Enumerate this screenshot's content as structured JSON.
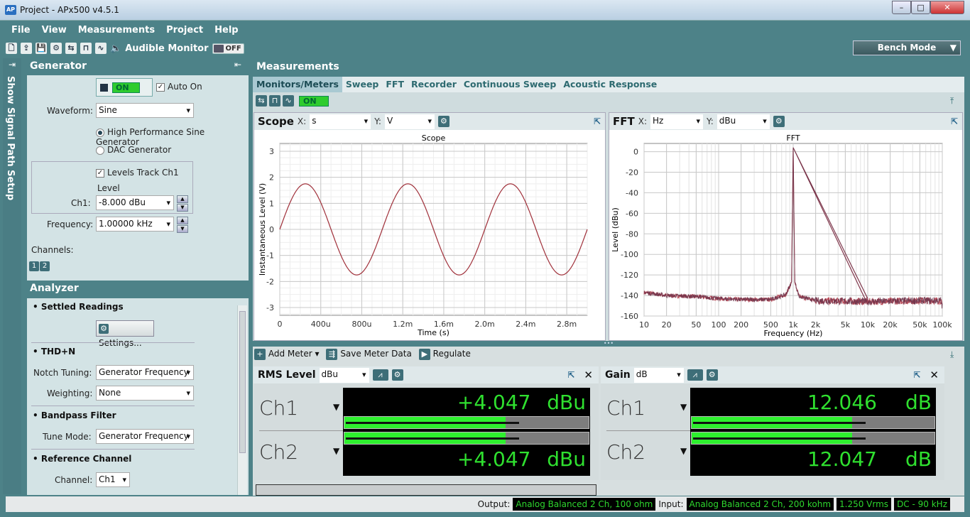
{
  "window": {
    "title": "Project - APx500 v4.5.1",
    "logo": "AP",
    "minimize": "–",
    "maximize": "□",
    "close": "✕"
  },
  "menu": [
    "File",
    "View",
    "Measurements",
    "Project",
    "Help"
  ],
  "toolbar": {
    "audible_monitor": "Audible Monitor",
    "audible_state": "OFF",
    "bench_mode": "Bench Mode"
  },
  "sidebar": {
    "signal_path": "Show Signal Path Setup"
  },
  "generator": {
    "title": "Generator",
    "state": "ON",
    "auto_on": "Auto On",
    "waveform_label": "Waveform:",
    "waveform": "Sine",
    "opt_hp": "High Performance Sine Generator",
    "opt_dac": "DAC Generator",
    "levels_track": "Levels Track Ch1",
    "level_label": "Level",
    "ch1_label": "Ch1:",
    "ch1_value": "-8.000 dBu",
    "freq_label": "Frequency:",
    "freq_value": "1.00000 kHz",
    "channels_label": "Channels:",
    "channels": [
      "1",
      "2"
    ]
  },
  "analyzer": {
    "title": "Analyzer",
    "settled": "Settled Readings",
    "settings_btn": "Settings...",
    "thdn": "THD+N",
    "notch_label": "Notch Tuning:",
    "notch": "Generator Frequency",
    "weighting_label": "Weighting:",
    "weighting": "None",
    "bandpass": "Bandpass Filter",
    "tune_label": "Tune Mode:",
    "tune": "Generator Frequency",
    "refch": "Reference Channel",
    "channel_label": "Channel:",
    "channel": "Ch1"
  },
  "measurements": {
    "title": "Measurements",
    "tabs": [
      "Monitors/Meters",
      "Sweep",
      "FFT",
      "Recorder",
      "Continuous Sweep",
      "Acoustic Response"
    ],
    "active_tab": "Monitors/Meters",
    "state": "ON"
  },
  "scope": {
    "title": "Scope",
    "x_label": "X:",
    "x_unit": "s",
    "y_label": "Y:",
    "y_unit": "V"
  },
  "fft": {
    "title": "FFT",
    "x_label": "X:",
    "x_unit": "Hz",
    "y_label": "Y:",
    "y_unit": "dBu"
  },
  "chart_data": [
    {
      "type": "line",
      "title": "Scope",
      "xlabel": "Time (s)",
      "ylabel": "Instantaneous Level (V)",
      "xlim": [
        0,
        0.003
      ],
      "ylim": [
        -3.3,
        3.3
      ],
      "grid": true,
      "xticks": [
        0,
        0.0004,
        0.0008,
        0.0012,
        0.0016,
        0.002,
        0.0024,
        0.0028
      ],
      "xtick_labels": [
        "0",
        "400u",
        "800u",
        "1.2m",
        "1.6m",
        "2.0m",
        "2.4m",
        "2.8m"
      ],
      "yticks": [
        3,
        2,
        1,
        0,
        -1,
        -2,
        -3
      ],
      "ytick_labels": [
        "3",
        "2",
        "1",
        "0",
        "-1",
        "-2",
        "-3"
      ],
      "series": [
        {
          "waveform": "sine",
          "amplitude_V": 1.75,
          "frequency_Hz": 1000,
          "color": "#a0303a"
        }
      ]
    },
    {
      "type": "line",
      "title": "FFT",
      "xlabel": "Frequency (Hz)",
      "ylabel": "Level (dBu)",
      "xscale": "log",
      "xlim": [
        10,
        100000
      ],
      "ylim": [
        -160,
        8
      ],
      "grid": true,
      "xticks": [
        10,
        20,
        50,
        100,
        200,
        500,
        1000,
        2000,
        5000,
        10000,
        20000,
        50000,
        100000
      ],
      "xtick_labels": [
        "10",
        "20",
        "50",
        "100",
        "200",
        "500",
        "1k",
        "2k",
        "5k",
        "10k",
        "20k",
        "50k",
        "100k"
      ],
      "yticks": [
        0,
        -20,
        -40,
        -60,
        -80,
        -100,
        -120,
        -140,
        -160
      ],
      "ytick_labels": [
        "0",
        "-20",
        "-40",
        "-60",
        "-80",
        "-100",
        "-120",
        "-140",
        "-160"
      ],
      "series": [
        {
          "color": "#b03040",
          "points": [
            [
              10,
              -137
            ],
            [
              20,
              -140
            ],
            [
              50,
              -141
            ],
            [
              100,
              -143
            ],
            [
              200,
              -144
            ],
            [
              500,
              -144
            ],
            [
              800,
              -139
            ],
            [
              950,
              -127
            ],
            [
              1000,
              4
            ],
            [
              1050,
              -127
            ],
            [
              1200,
              -141
            ],
            [
              2000,
              -145
            ],
            [
              10000,
              -146
            ],
            [
              50000,
              -145
            ],
            [
              95000,
              -145
            ],
            [
              100000,
              -151
            ]
          ]
        }
      ]
    }
  ],
  "meter_toolbar": {
    "add": "Add Meter",
    "save": "Save Meter Data",
    "regulate": "Regulate"
  },
  "meters": [
    {
      "title": "RMS Level",
      "unit_select": "dBu",
      "channels": [
        {
          "name": "Ch1",
          "value": "+4.047",
          "unit": "dBu"
        },
        {
          "name": "Ch2",
          "value": "+4.047",
          "unit": "dBu"
        }
      ],
      "bar_fraction": 0.66
    },
    {
      "title": "Gain",
      "unit_select": "dB",
      "channels": [
        {
          "name": "Ch1",
          "value": "12.046",
          "unit": "dB"
        },
        {
          "name": "Ch2",
          "value": "12.047",
          "unit": "dB"
        }
      ],
      "bar_fraction": 0.66
    }
  ],
  "status": {
    "output_label": "Output:",
    "output": "Analog Balanced 2 Ch, 100 ohm",
    "input_label": "Input:",
    "input": "Analog Balanced 2 Ch, 200 kohm",
    "range": "1.250 Vrms",
    "bandwidth": "DC - 90 kHz"
  },
  "colors": {
    "frame": "#4d8288",
    "panel": "#d3e3e5",
    "meter_green": "#2fe02f",
    "trace": "#a0303a"
  }
}
